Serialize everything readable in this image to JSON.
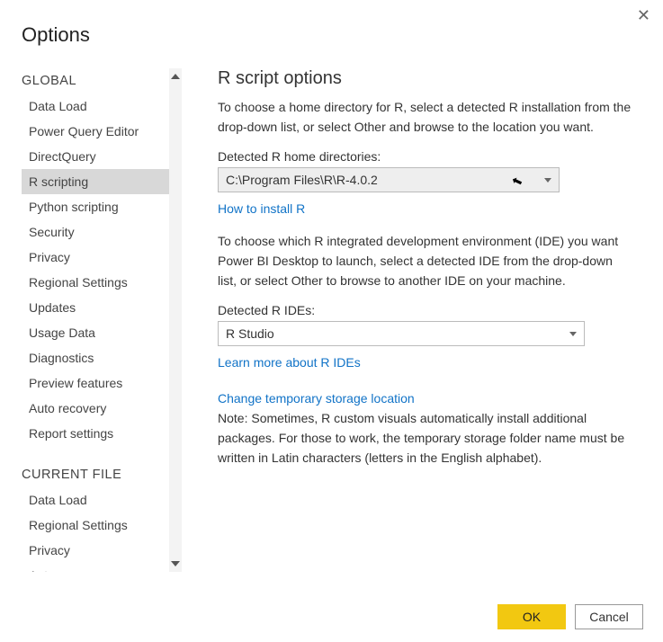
{
  "dialog": {
    "title": "Options",
    "close_symbol": "✕"
  },
  "sidebar": {
    "global_header": "GLOBAL",
    "global_items": [
      "Data Load",
      "Power Query Editor",
      "DirectQuery",
      "R scripting",
      "Python scripting",
      "Security",
      "Privacy",
      "Regional Settings",
      "Updates",
      "Usage Data",
      "Diagnostics",
      "Preview features",
      "Auto recovery",
      "Report settings"
    ],
    "global_selected_index": 3,
    "current_header": "CURRENT FILE",
    "current_items": [
      "Data Load",
      "Regional Settings",
      "Privacy",
      "Auto recovery"
    ]
  },
  "main": {
    "heading": "R script options",
    "intro": "To choose a home directory for R, select a detected R installation from the drop-down list, or select Other and browse to the location you want.",
    "home_label": "Detected R home directories:",
    "home_value": "C:\\Program Files\\R\\R-4.0.2",
    "install_link": "How to install R",
    "ide_intro": "To choose which R integrated development environment (IDE) you want Power BI Desktop to launch, select a detected IDE from the drop-down list, or select Other to browse to another IDE on your machine.",
    "ide_label": "Detected R IDEs:",
    "ide_value": "R Studio",
    "ide_link": "Learn more about R IDEs",
    "temp_link": "Change temporary storage location",
    "note": "Note: Sometimes, R custom visuals automatically install additional packages. For those to work, the temporary storage folder name must be written in Latin characters (letters in the English alphabet)."
  },
  "footer": {
    "ok": "OK",
    "cancel": "Cancel"
  }
}
